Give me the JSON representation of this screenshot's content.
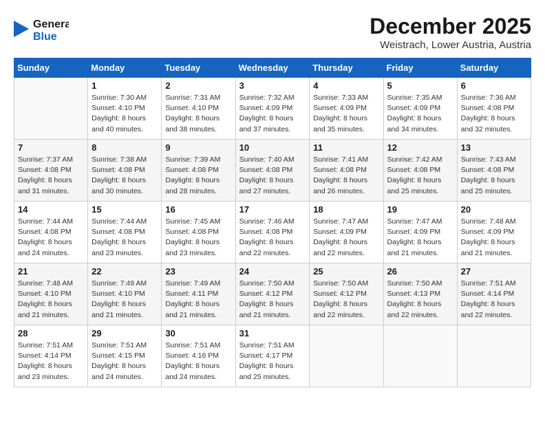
{
  "header": {
    "logo_line1": "General",
    "logo_line2": "Blue",
    "month": "December 2025",
    "location": "Weistrach, Lower Austria, Austria"
  },
  "weekdays": [
    "Sunday",
    "Monday",
    "Tuesday",
    "Wednesday",
    "Thursday",
    "Friday",
    "Saturday"
  ],
  "weeks": [
    [
      {
        "day": "",
        "sunrise": "",
        "sunset": "",
        "daylight": ""
      },
      {
        "day": "1",
        "sunrise": "Sunrise: 7:30 AM",
        "sunset": "Sunset: 4:10 PM",
        "daylight": "Daylight: 8 hours and 40 minutes."
      },
      {
        "day": "2",
        "sunrise": "Sunrise: 7:31 AM",
        "sunset": "Sunset: 4:10 PM",
        "daylight": "Daylight: 8 hours and 38 minutes."
      },
      {
        "day": "3",
        "sunrise": "Sunrise: 7:32 AM",
        "sunset": "Sunset: 4:09 PM",
        "daylight": "Daylight: 8 hours and 37 minutes."
      },
      {
        "day": "4",
        "sunrise": "Sunrise: 7:33 AM",
        "sunset": "Sunset: 4:09 PM",
        "daylight": "Daylight: 8 hours and 35 minutes."
      },
      {
        "day": "5",
        "sunrise": "Sunrise: 7:35 AM",
        "sunset": "Sunset: 4:09 PM",
        "daylight": "Daylight: 8 hours and 34 minutes."
      },
      {
        "day": "6",
        "sunrise": "Sunrise: 7:36 AM",
        "sunset": "Sunset: 4:08 PM",
        "daylight": "Daylight: 8 hours and 32 minutes."
      }
    ],
    [
      {
        "day": "7",
        "sunrise": "Sunrise: 7:37 AM",
        "sunset": "Sunset: 4:08 PM",
        "daylight": "Daylight: 8 hours and 31 minutes."
      },
      {
        "day": "8",
        "sunrise": "Sunrise: 7:38 AM",
        "sunset": "Sunset: 4:08 PM",
        "daylight": "Daylight: 8 hours and 30 minutes."
      },
      {
        "day": "9",
        "sunrise": "Sunrise: 7:39 AM",
        "sunset": "Sunset: 4:08 PM",
        "daylight": "Daylight: 8 hours and 28 minutes."
      },
      {
        "day": "10",
        "sunrise": "Sunrise: 7:40 AM",
        "sunset": "Sunset: 4:08 PM",
        "daylight": "Daylight: 8 hours and 27 minutes."
      },
      {
        "day": "11",
        "sunrise": "Sunrise: 7:41 AM",
        "sunset": "Sunset: 4:08 PM",
        "daylight": "Daylight: 8 hours and 26 minutes."
      },
      {
        "day": "12",
        "sunrise": "Sunrise: 7:42 AM",
        "sunset": "Sunset: 4:08 PM",
        "daylight": "Daylight: 8 hours and 25 minutes."
      },
      {
        "day": "13",
        "sunrise": "Sunrise: 7:43 AM",
        "sunset": "Sunset: 4:08 PM",
        "daylight": "Daylight: 8 hours and 25 minutes."
      }
    ],
    [
      {
        "day": "14",
        "sunrise": "Sunrise: 7:44 AM",
        "sunset": "Sunset: 4:08 PM",
        "daylight": "Daylight: 8 hours and 24 minutes."
      },
      {
        "day": "15",
        "sunrise": "Sunrise: 7:44 AM",
        "sunset": "Sunset: 4:08 PM",
        "daylight": "Daylight: 8 hours and 23 minutes."
      },
      {
        "day": "16",
        "sunrise": "Sunrise: 7:45 AM",
        "sunset": "Sunset: 4:08 PM",
        "daylight": "Daylight: 8 hours and 23 minutes."
      },
      {
        "day": "17",
        "sunrise": "Sunrise: 7:46 AM",
        "sunset": "Sunset: 4:08 PM",
        "daylight": "Daylight: 8 hours and 22 minutes."
      },
      {
        "day": "18",
        "sunrise": "Sunrise: 7:47 AM",
        "sunset": "Sunset: 4:09 PM",
        "daylight": "Daylight: 8 hours and 22 minutes."
      },
      {
        "day": "19",
        "sunrise": "Sunrise: 7:47 AM",
        "sunset": "Sunset: 4:09 PM",
        "daylight": "Daylight: 8 hours and 21 minutes."
      },
      {
        "day": "20",
        "sunrise": "Sunrise: 7:48 AM",
        "sunset": "Sunset: 4:09 PM",
        "daylight": "Daylight: 8 hours and 21 minutes."
      }
    ],
    [
      {
        "day": "21",
        "sunrise": "Sunrise: 7:48 AM",
        "sunset": "Sunset: 4:10 PM",
        "daylight": "Daylight: 8 hours and 21 minutes."
      },
      {
        "day": "22",
        "sunrise": "Sunrise: 7:49 AM",
        "sunset": "Sunset: 4:10 PM",
        "daylight": "Daylight: 8 hours and 21 minutes."
      },
      {
        "day": "23",
        "sunrise": "Sunrise: 7:49 AM",
        "sunset": "Sunset: 4:11 PM",
        "daylight": "Daylight: 8 hours and 21 minutes."
      },
      {
        "day": "24",
        "sunrise": "Sunrise: 7:50 AM",
        "sunset": "Sunset: 4:12 PM",
        "daylight": "Daylight: 8 hours and 21 minutes."
      },
      {
        "day": "25",
        "sunrise": "Sunrise: 7:50 AM",
        "sunset": "Sunset: 4:12 PM",
        "daylight": "Daylight: 8 hours and 22 minutes."
      },
      {
        "day": "26",
        "sunrise": "Sunrise: 7:50 AM",
        "sunset": "Sunset: 4:13 PM",
        "daylight": "Daylight: 8 hours and 22 minutes."
      },
      {
        "day": "27",
        "sunrise": "Sunrise: 7:51 AM",
        "sunset": "Sunset: 4:14 PM",
        "daylight": "Daylight: 8 hours and 22 minutes."
      }
    ],
    [
      {
        "day": "28",
        "sunrise": "Sunrise: 7:51 AM",
        "sunset": "Sunset: 4:14 PM",
        "daylight": "Daylight: 8 hours and 23 minutes."
      },
      {
        "day": "29",
        "sunrise": "Sunrise: 7:51 AM",
        "sunset": "Sunset: 4:15 PM",
        "daylight": "Daylight: 8 hours and 24 minutes."
      },
      {
        "day": "30",
        "sunrise": "Sunrise: 7:51 AM",
        "sunset": "Sunset: 4:16 PM",
        "daylight": "Daylight: 8 hours and 24 minutes."
      },
      {
        "day": "31",
        "sunrise": "Sunrise: 7:51 AM",
        "sunset": "Sunset: 4:17 PM",
        "daylight": "Daylight: 8 hours and 25 minutes."
      },
      {
        "day": "",
        "sunrise": "",
        "sunset": "",
        "daylight": ""
      },
      {
        "day": "",
        "sunrise": "",
        "sunset": "",
        "daylight": ""
      },
      {
        "day": "",
        "sunrise": "",
        "sunset": "",
        "daylight": ""
      }
    ]
  ]
}
